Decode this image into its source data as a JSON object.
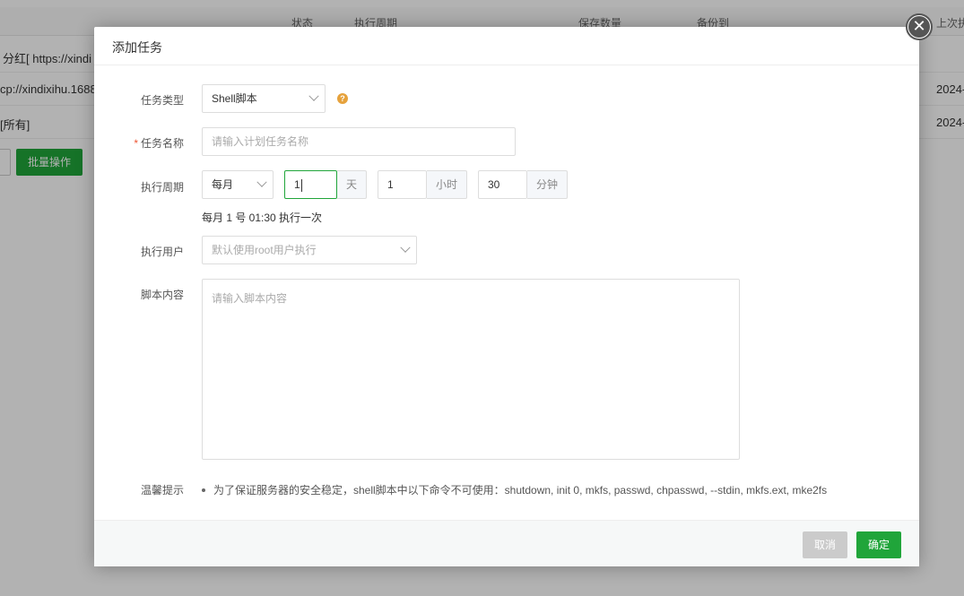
{
  "background": {
    "table_headers": [
      "状态",
      "执行周期",
      "保存数量",
      "备份到",
      "上次执"
    ],
    "rows": [
      {
        "name": "分红[ https://xindi",
        "date": ""
      },
      {
        "name": "cp://xindixihu.1688",
        "date": "2024-"
      },
      {
        "name": "[所有]",
        "date": "2024-"
      }
    ],
    "batch_button": "批量操作"
  },
  "modal": {
    "title": "添加任务",
    "close_icon": "close-icon",
    "task_type": {
      "label": "任务类型",
      "value": "Shell脚本",
      "help_icon": "question-icon"
    },
    "task_name": {
      "label": "任务名称",
      "required_mark": "*",
      "placeholder": "请输入计划任务名称"
    },
    "cycle": {
      "label": "执行周期",
      "period": "每月",
      "day_value": "1",
      "day_unit": "天",
      "hour_value": "1",
      "hour_unit": "小时",
      "minute_value": "30",
      "minute_unit": "分钟",
      "summary": "每月 1 号 01:30 执行一次"
    },
    "user": {
      "label": "执行用户",
      "placeholder": "默认使用root用户执行"
    },
    "script": {
      "label": "脚本内容",
      "placeholder": "请输入脚本内容"
    },
    "tip": {
      "label": "温馨提示",
      "text": "为了保证服务器的安全稳定，shell脚本中以下命令不可使用：shutdown, init 0, mkfs, passwd, chpasswd, --stdin, mkfs.ext, mke2fs"
    },
    "buttons": {
      "cancel": "取消",
      "confirm": "确定"
    }
  }
}
